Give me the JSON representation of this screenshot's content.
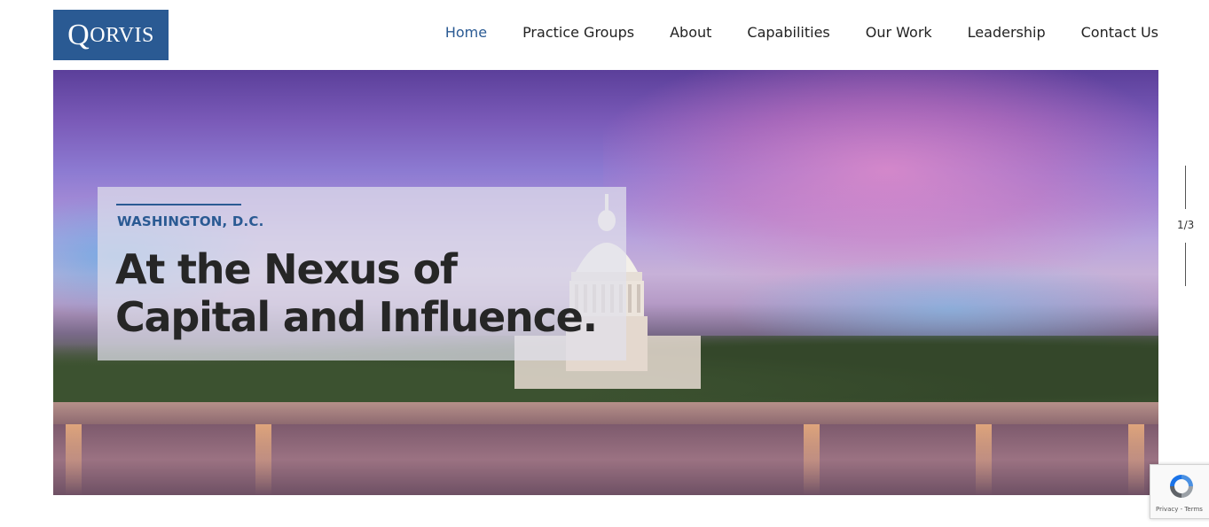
{
  "logo": {
    "first_letter": "Q",
    "rest": "ORVIS"
  },
  "nav": {
    "items": [
      {
        "label": "Home",
        "active": true
      },
      {
        "label": "Practice Groups"
      },
      {
        "label": "About"
      },
      {
        "label": "Capabilities"
      },
      {
        "label": "Our Work"
      },
      {
        "label": "Leadership"
      },
      {
        "label": "Contact Us"
      }
    ]
  },
  "hero": {
    "eyebrow": "WASHINGTON, D.C.",
    "headline_line1": "At the Nexus of",
    "headline_line2": "Capital and Influence.",
    "slide_indicator": "1/3"
  },
  "recaptcha": {
    "terms": "Privacy - Terms"
  },
  "colors": {
    "brand": "#2a5a93",
    "text": "#222222"
  }
}
